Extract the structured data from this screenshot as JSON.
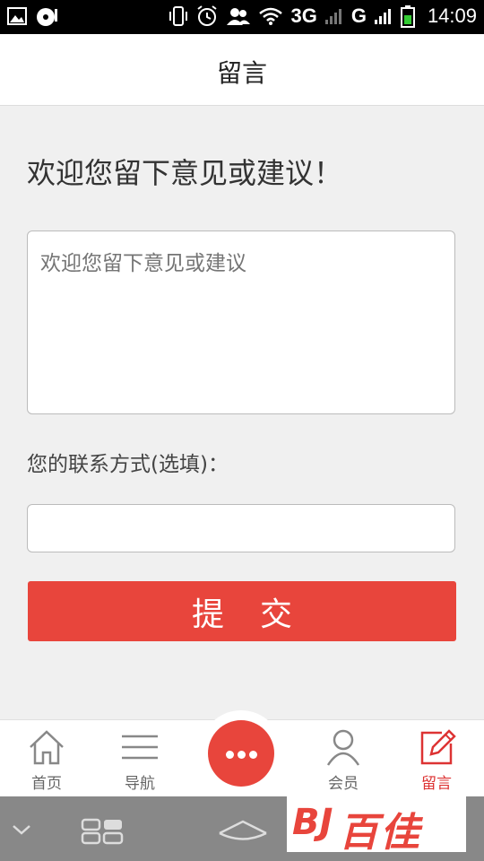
{
  "status_bar": {
    "network_3g": "3G",
    "network_g": "G",
    "time": "14:09"
  },
  "header": {
    "title": "留言"
  },
  "form": {
    "intro": "欢迎您留下意见或建议！",
    "message_placeholder": "欢迎您留下意见或建议",
    "contact_label": "您的联系方式(选填)：",
    "contact_value": "",
    "submit_label": "提交"
  },
  "tabs": [
    {
      "label": "首页",
      "icon": "home-icon"
    },
    {
      "label": "导航",
      "icon": "menu-icon"
    },
    {
      "label": "会员",
      "icon": "user-icon"
    },
    {
      "label": "留言",
      "icon": "edit-icon",
      "active": true
    }
  ],
  "center_button": {
    "icon": "more-icon"
  },
  "watermark": {
    "mark": "BJ",
    "text": "百佳"
  },
  "colors": {
    "accent": "#e8453c"
  }
}
